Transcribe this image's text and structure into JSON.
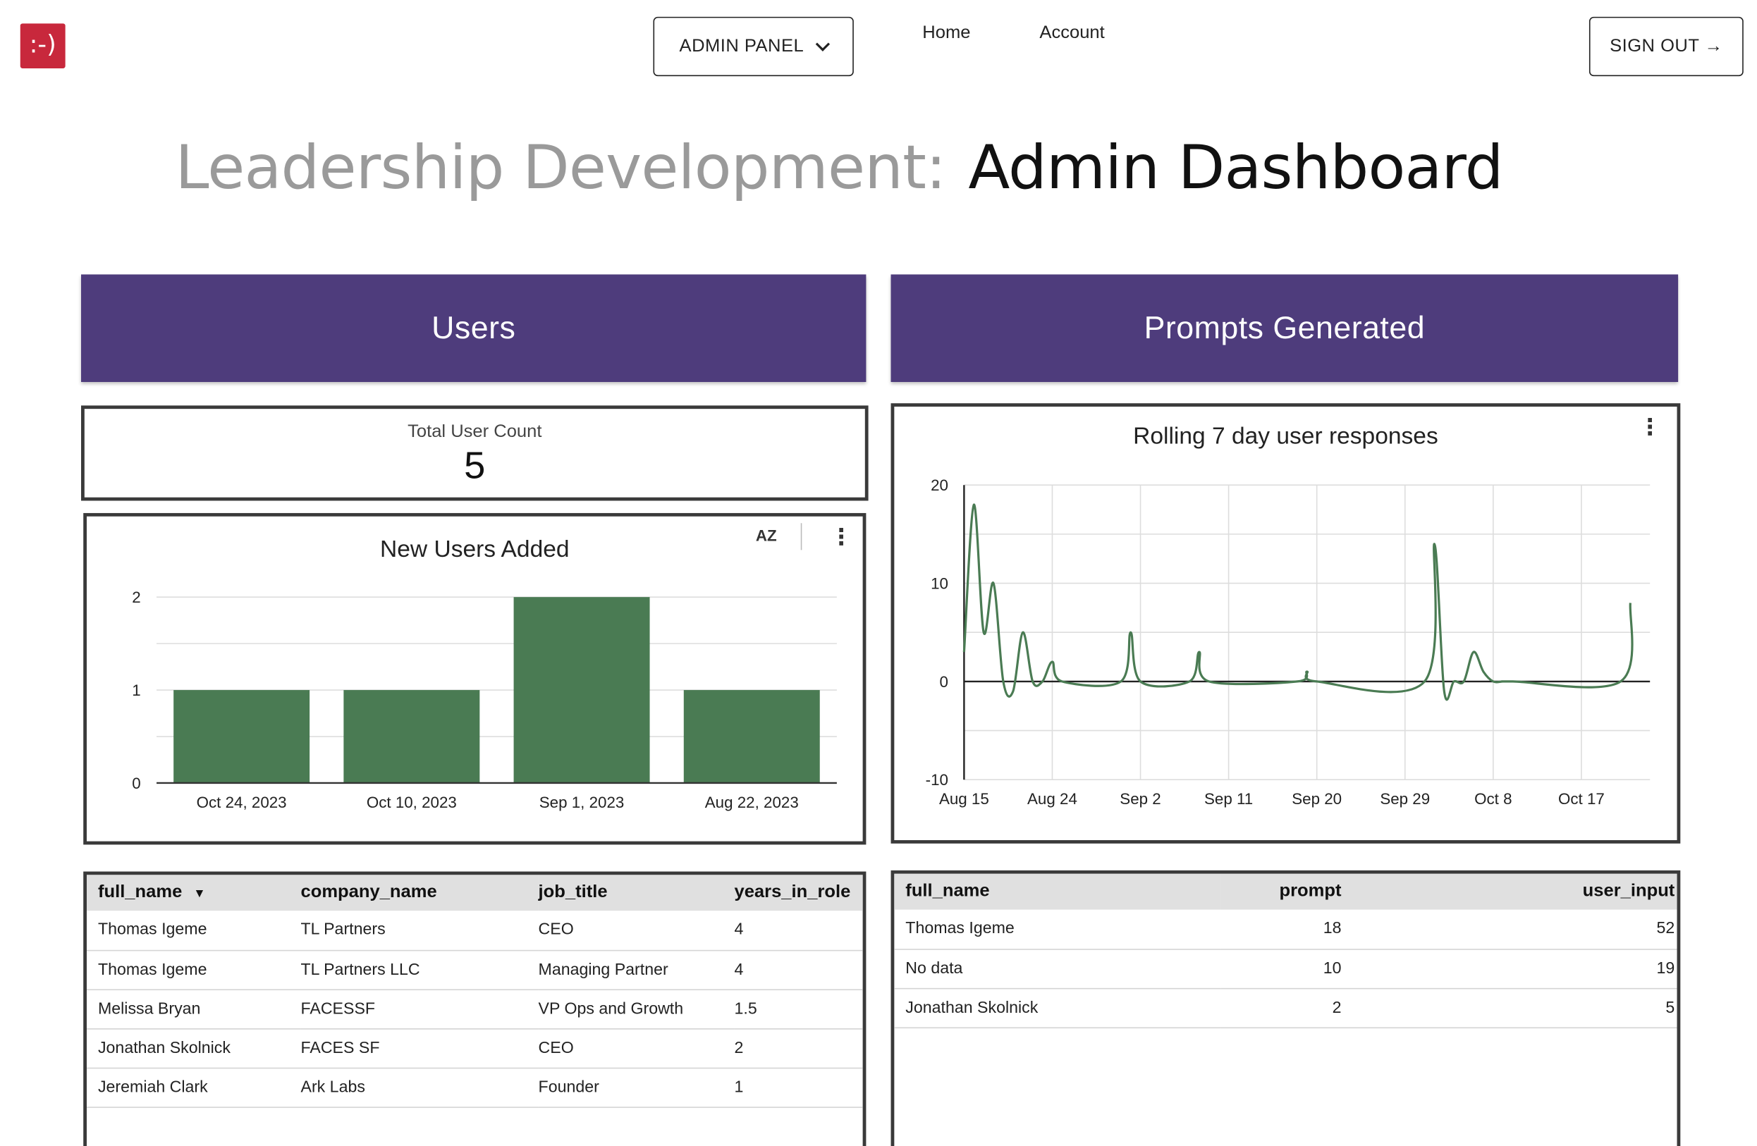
{
  "header": {
    "logo_text": ":-)",
    "admin_panel_label": "ADMIN PANEL",
    "admin_panel_chevron": "⌄",
    "nav": {
      "home": "Home",
      "account": "Account"
    },
    "sign_out_label": "SIGN OUT →"
  },
  "title": {
    "prefix": "Leadership Development:",
    "main": "Admin Dashboard"
  },
  "sections": {
    "users": "Users",
    "prompts": "Prompts Generated"
  },
  "user_count": {
    "label": "Total User Count",
    "value": "5"
  },
  "new_users_chart": {
    "title": "New Users Added",
    "sort_icon": "AZ",
    "menu_icon": "⋮"
  },
  "responses_chart": {
    "title": "Rolling 7 day user responses",
    "menu_icon": "⋮"
  },
  "users_table": {
    "columns": [
      "full_name",
      "company_name",
      "job_title",
      "years_in_role"
    ],
    "sort_indicator": "▼",
    "rows": [
      [
        "Thomas Igeme",
        "TL Partners",
        "CEO",
        "4"
      ],
      [
        "Thomas Igeme",
        "TL Partners LLC",
        "Managing Partner",
        "4"
      ],
      [
        "Melissa Bryan",
        "FACESSF",
        "VP Ops and Growth",
        "1.5"
      ],
      [
        "Jonathan Skolnick",
        "FACES SF",
        "CEO",
        "2"
      ],
      [
        "Jeremiah Clark",
        "Ark Labs",
        "Founder",
        "1"
      ]
    ]
  },
  "prompts_table": {
    "columns": [
      "full_name",
      "prompt",
      "user_input"
    ],
    "rows": [
      [
        "Thomas Igeme",
        "18",
        "52"
      ],
      [
        "No data",
        "10",
        "19"
      ],
      [
        "Jonathan Skolnick",
        "2",
        "5"
      ]
    ]
  },
  "colors": {
    "accent": "#4e3c7c",
    "bar": "#4a7b53",
    "line": "#4a7b53",
    "logo": "#c8283c"
  },
  "chart_data": [
    {
      "type": "bar",
      "title": "New Users Added",
      "categories": [
        "Oct 24, 2023",
        "Oct 10, 2023",
        "Sep 1, 2023",
        "Aug 22, 2023"
      ],
      "values": [
        1,
        1,
        2,
        1
      ],
      "ylim": [
        0,
        2
      ],
      "yticks": [
        0,
        1,
        2
      ],
      "grid": true,
      "legend": "none"
    },
    {
      "type": "line",
      "title": "Rolling 7 day user responses",
      "x": [
        "Aug 15",
        "Aug 16",
        "Aug 17",
        "Aug 18",
        "Aug 19",
        "Aug 20",
        "Aug 21",
        "Aug 22",
        "Aug 23",
        "Aug 24",
        "Aug 25",
        "Aug 31",
        "Sep 1",
        "Sep 2",
        "Sep 7",
        "Sep 8",
        "Sep 9",
        "Sep 18",
        "Sep 19",
        "Sep 20",
        "Oct 1",
        "Oct 2",
        "Oct 3",
        "Oct 4",
        "Oct 5",
        "Oct 6",
        "Oct 7",
        "Oct 8",
        "Oct 9",
        "Oct 10",
        "Oct 21",
        "Oct 22"
      ],
      "values": [
        3,
        18,
        5,
        10,
        0,
        -1,
        5,
        0,
        0,
        2,
        0,
        0,
        5,
        0,
        0,
        3,
        0,
        0,
        1,
        0,
        0,
        14,
        -1,
        0,
        0,
        3,
        1,
        0,
        0,
        0,
        0,
        8
      ],
      "xticks": [
        "Aug 15",
        "Aug 24",
        "Sep 2",
        "Sep 11",
        "Sep 20",
        "Sep 29",
        "Oct 8",
        "Oct 17"
      ],
      "ylim": [
        -10,
        20
      ],
      "yticks": [
        -10,
        0,
        10,
        20
      ],
      "grid": true,
      "legend": "none"
    }
  ]
}
